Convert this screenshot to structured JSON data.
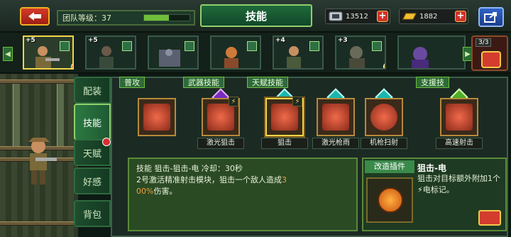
{
  "header": {
    "team_level_label": "团队等级：37",
    "title": "技能",
    "resource1": "13512",
    "resource2": "1882"
  },
  "heroes": {
    "plus_labels": [
      "+5",
      "+5",
      "",
      "",
      "+4",
      "+3",
      "",
      ""
    ],
    "squad_count": "3/3"
  },
  "side_tabs": [
    "配装",
    "技能",
    "天赋",
    "好感",
    "背包"
  ],
  "categories": {
    "normal": "普攻",
    "weapon": "武器技能",
    "talent": "天赋技能",
    "support": "支援技"
  },
  "skills": [
    {
      "name": ""
    },
    {
      "name": "激光狙击",
      "lvl": "⚡"
    },
    {
      "name": "狙击",
      "lvl": "⚡"
    },
    {
      "name": "激光枪雨"
    },
    {
      "name": "机枪扫射"
    },
    {
      "name": "高速射击"
    }
  ],
  "description": {
    "line1": "技能 狙击-狙击-电 冷却：30秒",
    "line2a": "2号激活精准射击模块，狙击一个敌人造成",
    "line2b": "3",
    "line3a": "00%",
    "line3b": "伤害。"
  },
  "detail": {
    "mod_label": "改造插件",
    "title": "狙击-电",
    "text": "狙击对目标额外附加1个⚡电标记。"
  },
  "colors": {
    "accent": "#8fd06a",
    "highlight": "#f2a03a"
  }
}
